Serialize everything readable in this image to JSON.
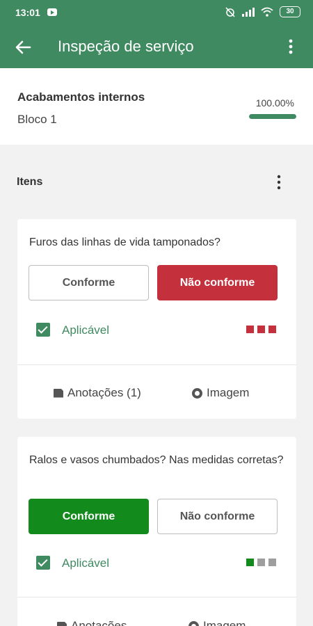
{
  "status_bar": {
    "time": "13:01",
    "battery": "30"
  },
  "app_bar": {
    "title": "Inspeção de serviço"
  },
  "header": {
    "title": "Acabamentos internos",
    "subtitle": "Bloco 1",
    "progress_label": "100.00%",
    "progress_fraction": 1.0
  },
  "section": {
    "label": "Itens"
  },
  "items": [
    {
      "question": "Furos das linhas de vida tamponados?",
      "conforme_label": "Conforme",
      "nao_conforme_label": "Não conforme",
      "selected": "nao_conforme",
      "aplicavel_label": "Aplicável",
      "aplicavel_checked": true,
      "indicators": [
        "#c4303b",
        "#c4303b",
        "#c4303b"
      ],
      "annotations_label": "Anotações (1)",
      "image_label": "Imagem"
    },
    {
      "question": "Ralos e vasos chumbados? Nas medidas corretas?",
      "conforme_label": "Conforme",
      "nao_conforme_label": "Não conforme",
      "selected": "conforme",
      "aplicavel_label": "Aplicável",
      "aplicavel_checked": true,
      "indicators": [
        "#128a1c",
        "#9e9e9e",
        "#9e9e9e"
      ],
      "annotations_label": "Anotações",
      "image_label": "Imagem"
    }
  ],
  "colors": {
    "primary": "#3f8a60",
    "danger": "#c4303b",
    "success": "#128a1c"
  }
}
